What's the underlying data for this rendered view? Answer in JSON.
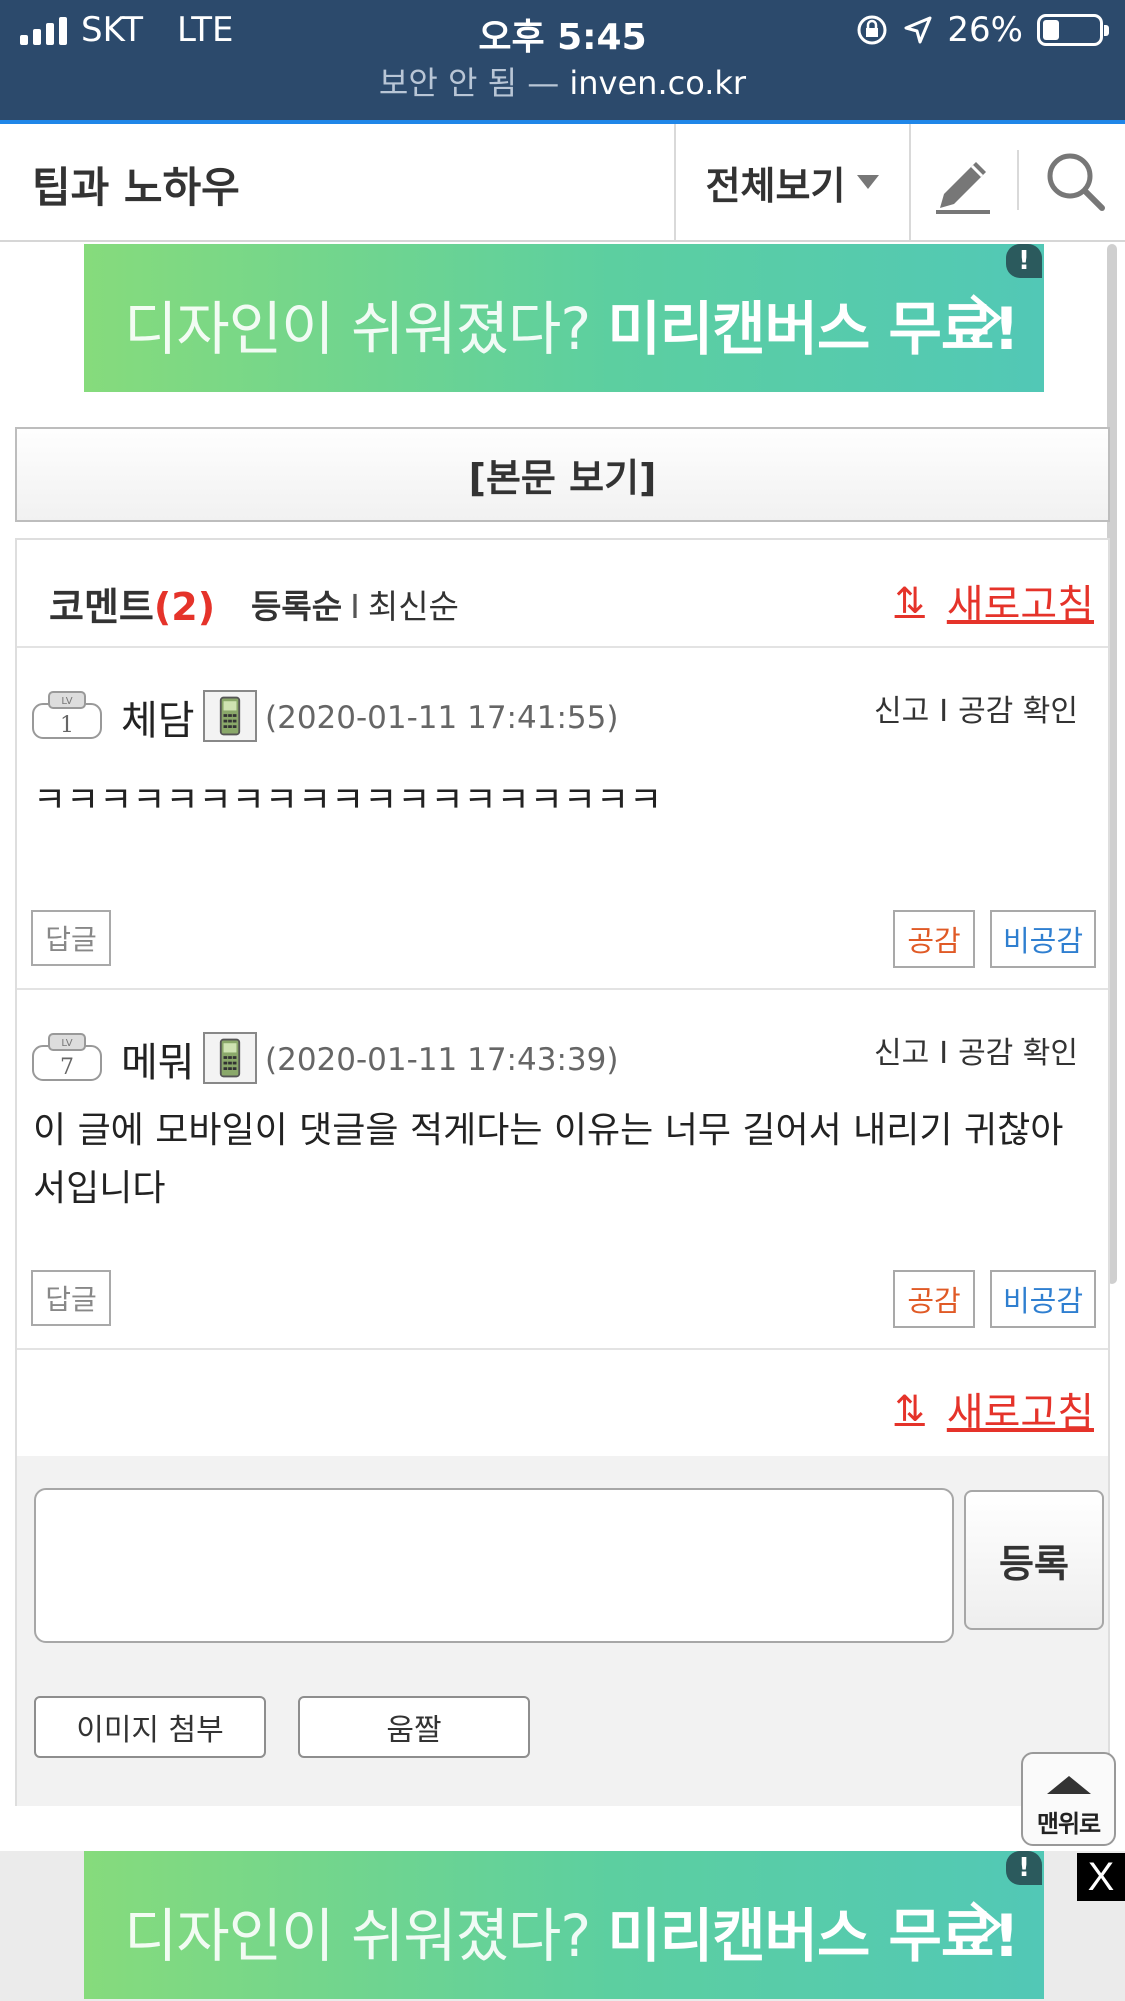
{
  "status_bar": {
    "carrier": "SKT",
    "network": "LTE",
    "time": "오후 5:45",
    "battery": "26%",
    "battery_level": 0.26,
    "url_insecure": "보안 안 됨",
    "url_sep": " — ",
    "url_domain": "inven.co.kr"
  },
  "header": {
    "title": "팁과 노하우",
    "view_all": "전체보기"
  },
  "ad": {
    "text_light": "디자인이 쉬워졌다? ",
    "text_bold": "미리캔버스 무료!",
    "badge": "!"
  },
  "view_body_button": "[본문 보기]",
  "comments_header": {
    "label": "코멘트",
    "count": "(2)",
    "sort_registered": "등록순",
    "sort_sep": "I",
    "sort_latest": "최신순",
    "refresh": "새로고침"
  },
  "comments": [
    {
      "level": "1",
      "author": "체담",
      "date": "(2020-01-11 17:41:55)",
      "report": "신고",
      "sep": "I",
      "like_check": "공감 확인",
      "text": "ㅋㅋㅋㅋㅋㅋㅋㅋㅋㅋㅋㅋㅋㅋㅋㅋㅋㅋㅋ",
      "reply": "답글",
      "like": "공감",
      "dislike": "비공감"
    },
    {
      "level": "7",
      "author": "메뭐",
      "date": "(2020-01-11 17:43:39)",
      "report": "신고",
      "sep": "I",
      "like_check": "공감 확인",
      "text": "이 글에 모바일이 댓글을 적게다는 이유는 너무 길어서 내리기 귀찮아서입니다",
      "reply": "답글",
      "like": "공감",
      "dislike": "비공감"
    }
  ],
  "footer_refresh": "새로고침",
  "write": {
    "submit": "등록",
    "attach_image": "이미지 첨부",
    "emoticon": "움짤"
  },
  "back_to_top": "맨위로",
  "close": "X"
}
